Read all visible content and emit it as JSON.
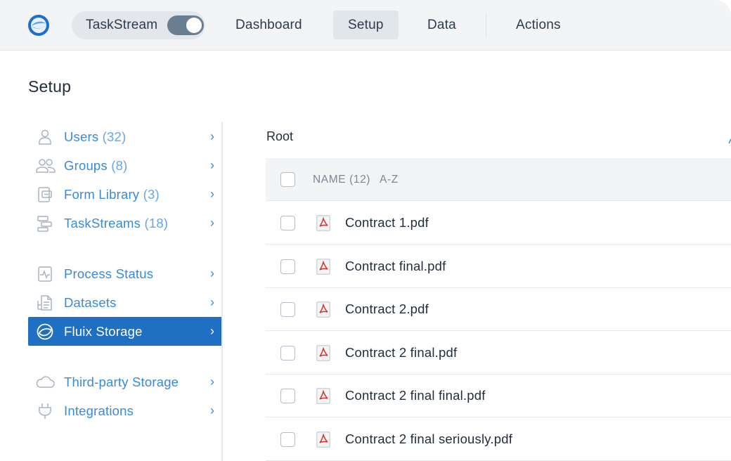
{
  "header": {
    "app_name": "TaskStream",
    "tabs": [
      {
        "label": "Dashboard"
      },
      {
        "label": "Setup"
      },
      {
        "label": "Data"
      },
      {
        "label": "Actions"
      }
    ],
    "active_tab": "Setup"
  },
  "page": {
    "title": "Setup",
    "breadcrumb": "Root"
  },
  "sidebar": {
    "items": [
      {
        "label": "Users",
        "count": "(32)",
        "icon": "user-icon"
      },
      {
        "label": "Groups",
        "count": "(8)",
        "icon": "group-icon"
      },
      {
        "label": "Form Library",
        "count": "(3)",
        "icon": "form-library-icon"
      },
      {
        "label": "TaskStreams",
        "count": "(18)",
        "icon": "taskstream-icon"
      },
      {
        "label": "Process Status",
        "count": "",
        "icon": "process-status-icon"
      },
      {
        "label": "Datasets",
        "count": "",
        "icon": "datasets-icon"
      },
      {
        "label": "Fluix Storage",
        "count": "",
        "icon": "fluix-storage-icon"
      },
      {
        "label": "Third-party Storage",
        "count": "",
        "icon": "cloud-icon"
      },
      {
        "label": "Integrations",
        "count": "",
        "icon": "plug-icon"
      }
    ],
    "active_item": "Fluix Storage",
    "chevron": "›"
  },
  "table": {
    "header_label": "NAME (12)",
    "sort_label": "A-Z",
    "rows": [
      {
        "name": "Contract 1.pdf",
        "icon": "pdf-icon"
      },
      {
        "name": "Contract final.pdf",
        "icon": "pdf-icon"
      },
      {
        "name": "Contract 2.pdf",
        "icon": "pdf-icon"
      },
      {
        "name": "Contract 2 final.pdf",
        "icon": "pdf-icon"
      },
      {
        "name": "Contract 2 final final.pdf",
        "icon": "pdf-icon"
      },
      {
        "name": "Contract 2 final seriously.pdf",
        "icon": "pdf-icon"
      }
    ]
  },
  "colors": {
    "accent": "#1f6fc3",
    "link": "#3a8ad6",
    "pdf_red": "#d6312b",
    "topbar_bg": "#f2f4f6"
  }
}
